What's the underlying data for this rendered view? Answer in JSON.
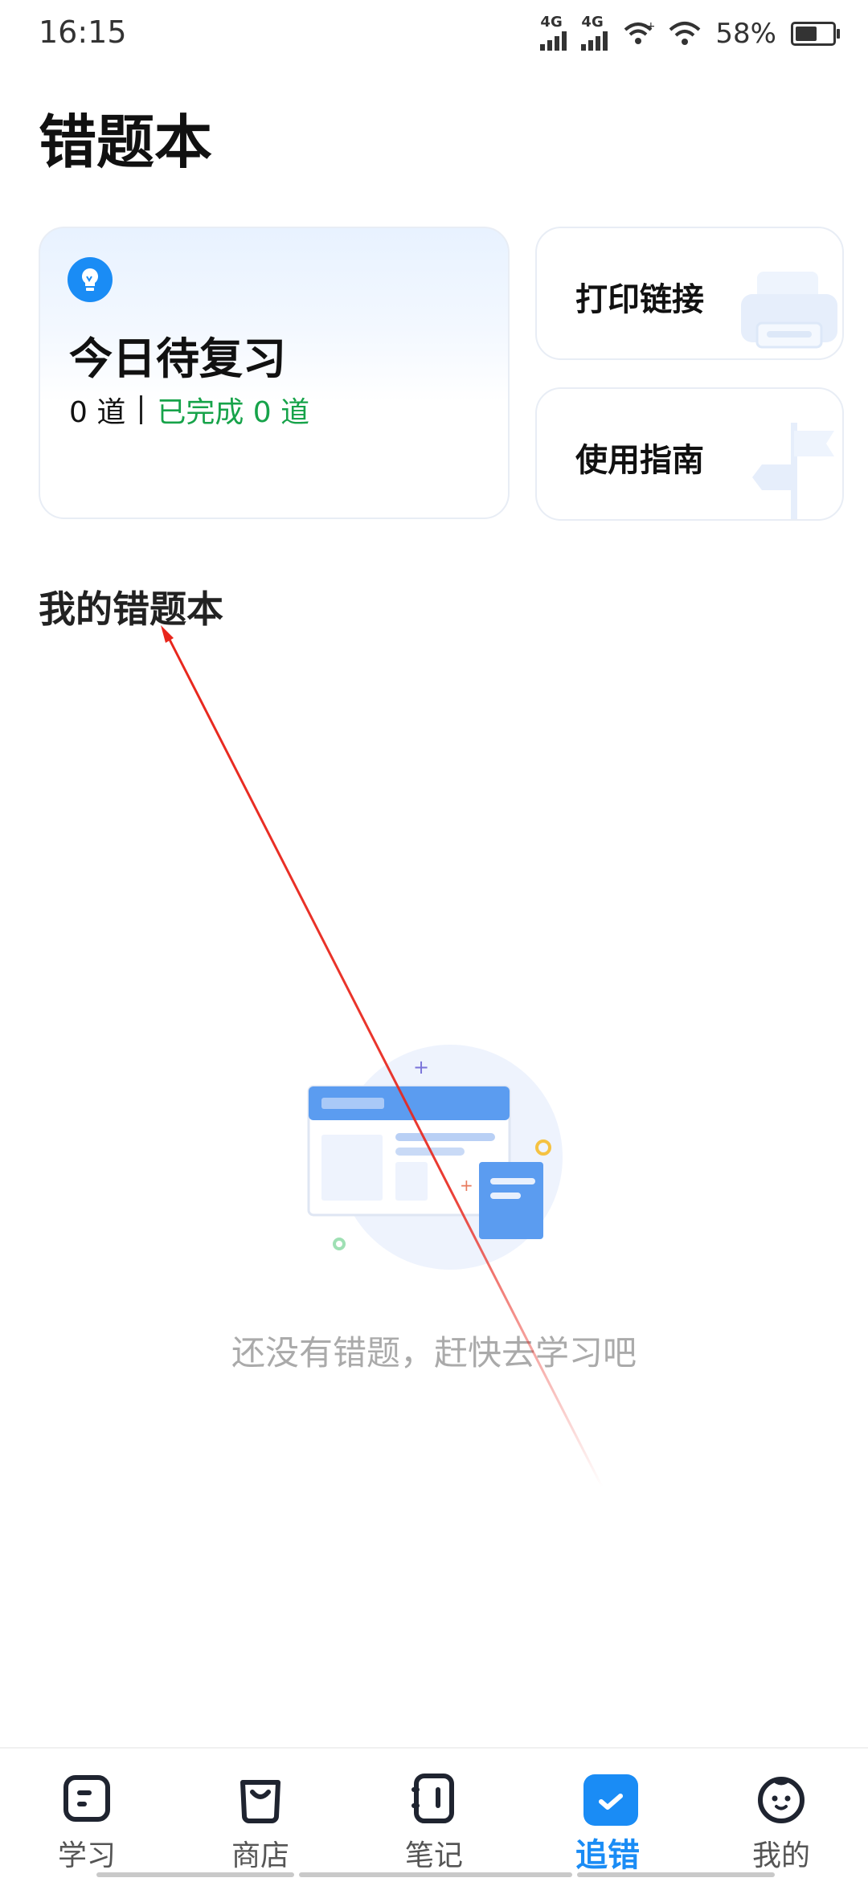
{
  "status_bar": {
    "time": "16:15",
    "network_1": "4G",
    "network_2": "4G",
    "battery": "58%"
  },
  "page": {
    "title": "错题本"
  },
  "review_card": {
    "title": "今日待复习",
    "pending": "0 道",
    "completed": "已完成 0 道",
    "icon": "lightbulb-icon"
  },
  "print_card": {
    "label": "打印链接",
    "icon": "printer-icon"
  },
  "guide_card": {
    "label": "使用指南",
    "icon": "signpost-icon"
  },
  "section": {
    "title": "我的错题本"
  },
  "empty_state": {
    "message": "还没有错题，赶快去学习吧"
  },
  "tabbar": {
    "items": [
      {
        "label": "学习",
        "icon": "study-icon"
      },
      {
        "label": "商店",
        "icon": "shop-bag-icon"
      },
      {
        "label": "笔记",
        "icon": "notebook-icon"
      },
      {
        "label": "追错",
        "icon": "check-icon",
        "active": true
      },
      {
        "label": "我的",
        "icon": "profile-face-icon"
      }
    ]
  },
  "colors": {
    "accent": "#1a8cf5",
    "completed_green": "#17a34a",
    "annotation_arrow": "#e8261c"
  }
}
